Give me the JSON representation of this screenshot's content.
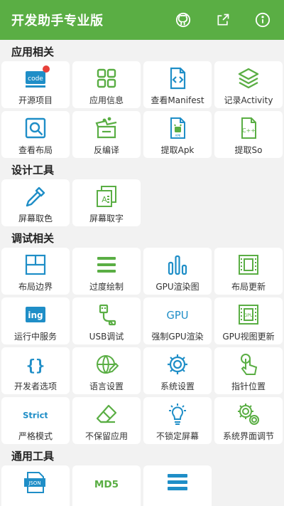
{
  "appbar": {
    "title": "开发助手专业版",
    "actions": [
      {
        "icon": "github-icon"
      },
      {
        "icon": "share-icon"
      },
      {
        "icon": "info-icon"
      }
    ]
  },
  "colors": {
    "primary": "#5aae44",
    "icon_blue": "#1f8ec7",
    "icon_green": "#5aae44",
    "badge": "#e8403a"
  },
  "sections": [
    {
      "title": "应用相关",
      "items": [
        {
          "label": "开源项目",
          "icon": "code-icon",
          "badge": true
        },
        {
          "label": "应用信息",
          "icon": "grid-icon"
        },
        {
          "label": "查看Manifest",
          "icon": "code-file-icon"
        },
        {
          "label": "记录Activity",
          "icon": "layers-icon"
        },
        {
          "label": "查看布局",
          "icon": "magnify-icon"
        },
        {
          "label": "反编译",
          "icon": "gift-box-icon"
        },
        {
          "label": "提取Apk",
          "icon": "apk-file-icon"
        },
        {
          "label": "提取So",
          "icon": "cpp-file-icon"
        }
      ]
    },
    {
      "title": "设计工具",
      "items": [
        {
          "label": "屏幕取色",
          "icon": "eyedropper-icon"
        },
        {
          "label": "屏幕取字",
          "icon": "text-copy-icon"
        }
      ]
    },
    {
      "title": "调试相关",
      "items": [
        {
          "label": "布局边界",
          "icon": "layout-bounds-icon"
        },
        {
          "label": "过度绘制",
          "icon": "overdraw-icon"
        },
        {
          "label": "GPU渲染图",
          "icon": "bar-chart-icon"
        },
        {
          "label": "布局更新",
          "icon": "layout-update-icon"
        },
        {
          "label": "运行中服务",
          "icon": "running-service-icon",
          "text": "ing"
        },
        {
          "label": "USB调试",
          "icon": "usb-icon"
        },
        {
          "label": "强制GPU渲染",
          "icon": "gpu-text-icon",
          "text": "GPU"
        },
        {
          "label": "GPU视图更新",
          "icon": "gpu-view-icon"
        },
        {
          "label": "开发者选项",
          "icon": "braces-icon",
          "text": "{ }"
        },
        {
          "label": "语言设置",
          "icon": "globe-icon"
        },
        {
          "label": "系统设置",
          "icon": "gear-icon"
        },
        {
          "label": "指针位置",
          "icon": "pointer-icon"
        },
        {
          "label": "严格模式",
          "icon": "strict-text-icon",
          "text": "Strict"
        },
        {
          "label": "不保留应用",
          "icon": "eraser-icon"
        },
        {
          "label": "不锁定屏幕",
          "icon": "bulb-icon"
        },
        {
          "label": "系统界面调节",
          "icon": "gears-icon"
        }
      ]
    },
    {
      "title": "通用工具",
      "items": [
        {
          "label": "",
          "icon": "json-icon",
          "text": "JSON"
        },
        {
          "label": "",
          "icon": "md5-icon",
          "text": "MD5"
        },
        {
          "label": "",
          "icon": "list-icon"
        }
      ]
    }
  ]
}
